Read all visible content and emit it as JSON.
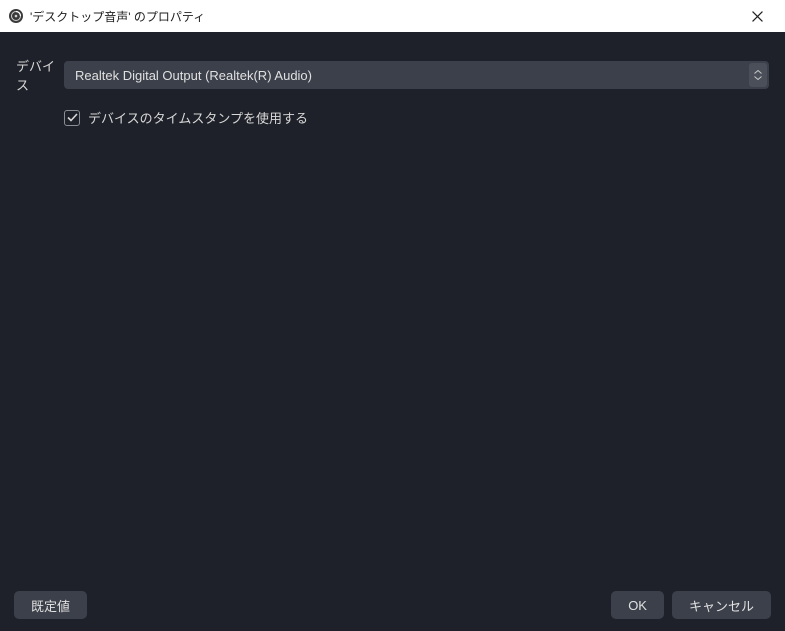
{
  "titlebar": {
    "title": "'デスクトップ音声' のプロパティ"
  },
  "form": {
    "device_label": "デバイス",
    "device_value": "Realtek Digital Output (Realtek(R) Audio)",
    "use_timestamp_label": "デバイスのタイムスタンプを使用する",
    "use_timestamp_checked": true
  },
  "footer": {
    "defaults_label": "既定値",
    "ok_label": "OK",
    "cancel_label": "キャンセル"
  }
}
